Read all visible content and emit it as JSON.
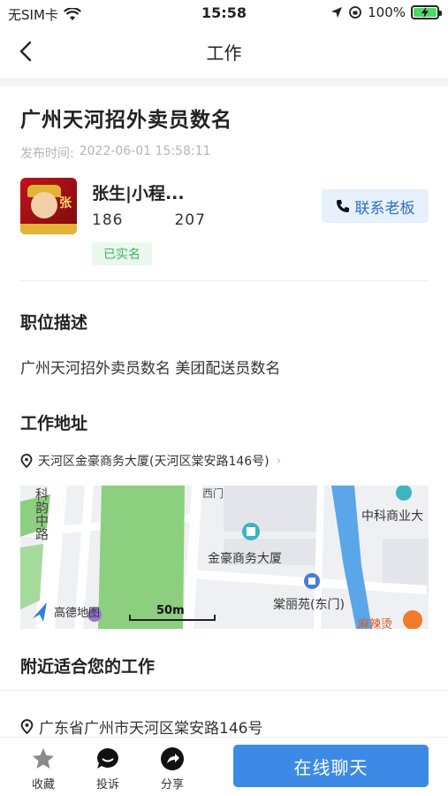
{
  "status_bar": {
    "carrier": "无SIM卡",
    "time": "15:58",
    "battery": "100%",
    "battery_level": 1.0
  },
  "nav": {
    "title": "工作",
    "back_icon": "chevron-left-icon"
  },
  "job": {
    "title": "广州天河招外卖员数名",
    "posted_label": "发布时间:",
    "posted_time": "2022-06-01 15:58:11"
  },
  "employer": {
    "name": "张生|小程...",
    "phone_prefix": "186",
    "phone_suffix": "207",
    "verified_label": "已实名",
    "avatar_char": "张",
    "contact_label": "联系老板"
  },
  "description": {
    "title": "职位描述",
    "text": "广州天河招外卖员数名 美团配送员数名"
  },
  "address": {
    "title": "工作地址",
    "text": "天河区金豪商务大厦(天河区棠安路146号)"
  },
  "map": {
    "road_label": "科韵中路",
    "poi_main": "金豪商务大厦",
    "poi_right": "中科商业大",
    "poi_bottom": "棠丽苑(东门)",
    "poi_restaurant": "麻辣烫",
    "gate_label": "西门",
    "provider": "高德地图",
    "scale": "50m",
    "colors": {
      "park": "#8ccf7e",
      "water": "#5aa6e8",
      "road": "#ffffff",
      "bg": "#eef0f3"
    }
  },
  "nearby": {
    "title": "附近适合您的工作",
    "address": "广东省广州市天河区棠安路146号"
  },
  "bottom_bar": {
    "favorite_label": "收藏",
    "report_label": "投诉",
    "share_label": "分享",
    "chat_label": "在线聊天"
  }
}
